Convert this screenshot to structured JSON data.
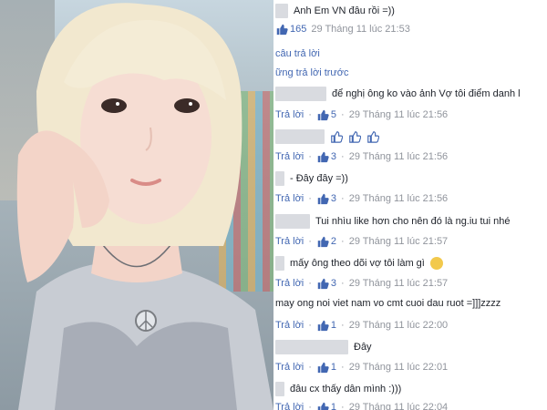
{
  "comments": [
    {
      "text": "Anh Em VN đâu rồi =))",
      "likes": "165",
      "time": "29 Tháng 11 lúc 21:53"
    },
    {
      "text": "để nghị ông ko vào ảnh Vợ tôi điểm danh l",
      "reply": "Trả lời",
      "likes": "5",
      "time": "29 Tháng 11 lúc 21:56"
    },
    {
      "text": "",
      "reply": "Trả lời",
      "likes": "3",
      "time": "29 Tháng 11 lúc 21:56"
    },
    {
      "text": "- Đây đây =))",
      "reply": "Trả lời",
      "likes": "3",
      "time": "29 Tháng 11 lúc 21:56"
    },
    {
      "text": "Tui nhìu like hơn cho nên đó là ng.iu tui nhé",
      "reply": "Trả lời",
      "likes": "2",
      "time": "29 Tháng 11 lúc 21:57"
    },
    {
      "text": "mấy ông theo dõi vợ tôi làm gì",
      "reply": "Trả lời",
      "likes": "3",
      "time": "29 Tháng 11 lúc 21:57"
    },
    {
      "text": "may ong noi viet nam vo cmt cuoi dau ruot =]]]zzzz",
      "reply": "Trả lời",
      "likes": "1",
      "time": "29 Tháng 11 lúc 22:00"
    },
    {
      "text": "Đây",
      "reply": "Trả lời",
      "likes": "1",
      "time": "29 Tháng 11 lúc 22:01"
    },
    {
      "text": "đâu cx thấy dân mình :)))",
      "reply": "Trả lời",
      "likes": "1",
      "time": "29 Tháng 11 lúc 22:04"
    }
  ],
  "links": {
    "replies": "câu trả lời",
    "previous": "ững trả lời trước"
  },
  "colors": {
    "link": "#4267b2",
    "meta": "#90949c",
    "text": "#1d2129",
    "blur": "#d9dbe0"
  }
}
